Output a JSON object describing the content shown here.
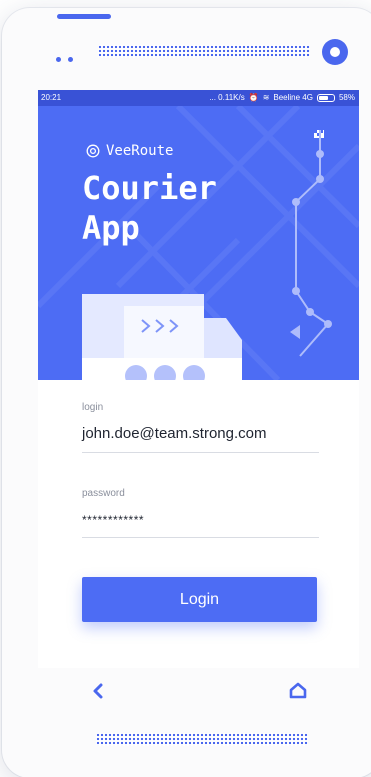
{
  "status_bar": {
    "time": "20:21",
    "network_speed": "... 0.11K/s",
    "carrier": "Beeline 4G",
    "battery": "58%"
  },
  "app": {
    "brand_name": "VeeRoute",
    "title_line1": "Courier",
    "title_line2": "App"
  },
  "form": {
    "login_label": "login",
    "login_value": "john.doe@team.strong.com",
    "password_label": "password",
    "password_value": "************",
    "submit_label": "Login"
  },
  "colors": {
    "accent": "#4d6cf4",
    "status_bar": "#3952d6"
  },
  "icons": {
    "back": "chevron-left-icon",
    "home": "home-icon"
  }
}
